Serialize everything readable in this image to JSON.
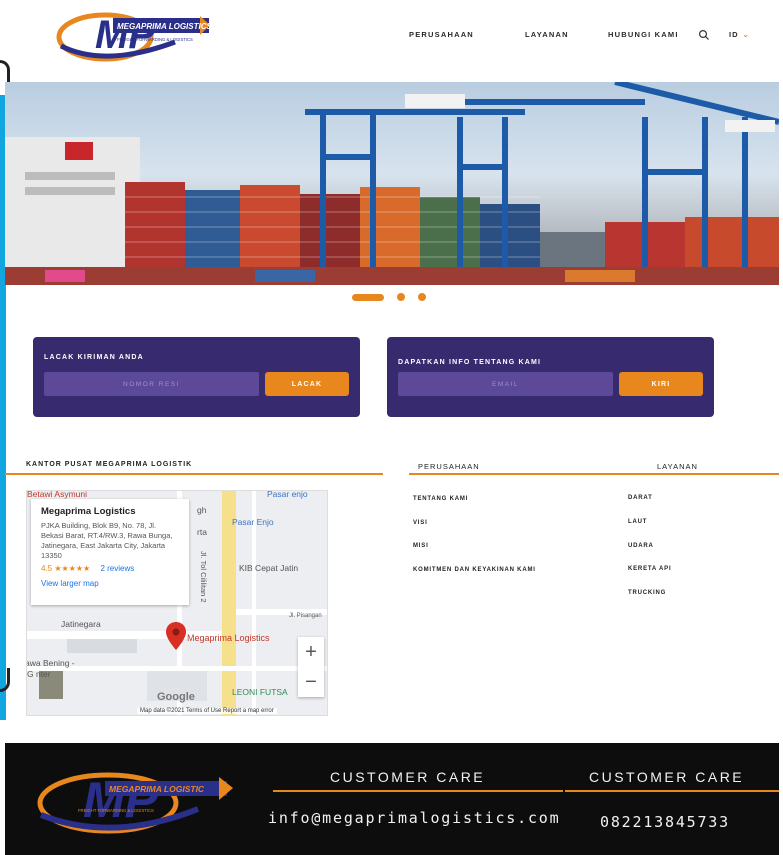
{
  "brand": {
    "name": "MEGAPRIMA LOGISTICS",
    "tagline": "FREIGHT FORWARDING & LOGISTICS",
    "initials": "MP",
    "colors": {
      "orange": "#e8871e",
      "navy": "#2a2f8a",
      "purple": "#382a6e",
      "blue": "#12a6e0"
    }
  },
  "nav": {
    "items": [
      {
        "label": "PERUSAHAAN"
      },
      {
        "label": "LAYANAN"
      },
      {
        "label": "HUBUNGI KAMI"
      }
    ],
    "search_icon": "search-icon",
    "language": "ID"
  },
  "hero": {
    "slides_total": 3,
    "active_slide": 1
  },
  "track": {
    "title": "LACAK KIRIMAN ANDA",
    "placeholder": "NOMOR RESI",
    "button": "LACAK"
  },
  "subscribe": {
    "title": "DAPATKAN INFO TENTANG KAMI",
    "placeholder": "EMAIL",
    "button": "KIRI"
  },
  "office": {
    "title": "KANTOR PUSAT MEGAPRIMA LOGISTIK",
    "map": {
      "place_name": "Megaprima Logistics",
      "address": "PJKA Building, Blok B9, No. 78, Jl. Bekasi Barat, RT.4/RW.3, Rawa Bunga, Jatinegara, East Jakarta City, Jakarta 13350",
      "rating": "4.5",
      "stars": "★★★★★",
      "reviews": "2 reviews",
      "view_larger": "View larger map",
      "labels": {
        "betawi": "Betawi Asymuni",
        "pasar_enjo_top": "Pasar enjo",
        "pasar_enjo": "Pasar Enjo",
        "kib": "KIB Cepat Jatin",
        "street": "Jl. Tol Cililitan 2",
        "pisangan": "Jl. Pisangan",
        "jatinegara": "Jatinegara",
        "marker": "Megaprima Logistics",
        "rawa": "awa Bening -",
        "center": "G   nter",
        "leoni": "LEONI FUTSA",
        "gh": "gh",
        "rta": "rta"
      },
      "google": "Google",
      "footer": "Map data ©2021    Terms of Use    Report a map error",
      "zoom_in": "+",
      "zoom_out": "−"
    }
  },
  "links": {
    "company_head": "PERUSAHAAN",
    "services_head": "LAYANAN",
    "company": [
      {
        "label": "TENTANG KAMI"
      },
      {
        "label": "VISI"
      },
      {
        "label": "MISI"
      },
      {
        "label": "KOMITMEN DAN KEYAKINAN KAMI"
      }
    ],
    "services": [
      {
        "label": "DARAT"
      },
      {
        "label": "LAUT"
      },
      {
        "label": "UDARA"
      },
      {
        "label": "KERETA API"
      },
      {
        "label": "TRUCKING"
      }
    ]
  },
  "footer": {
    "brand_name": "MEGAPRIMA LOGISTIC",
    "brand_tagline": "FREIGHT FORWARDING & LOGISTICS",
    "care_head_1": "CUSTOMER CARE",
    "care_head_2": "CUSTOMER CARE",
    "email": "info@megaprimalogistics.com",
    "phone": "082213845733"
  }
}
